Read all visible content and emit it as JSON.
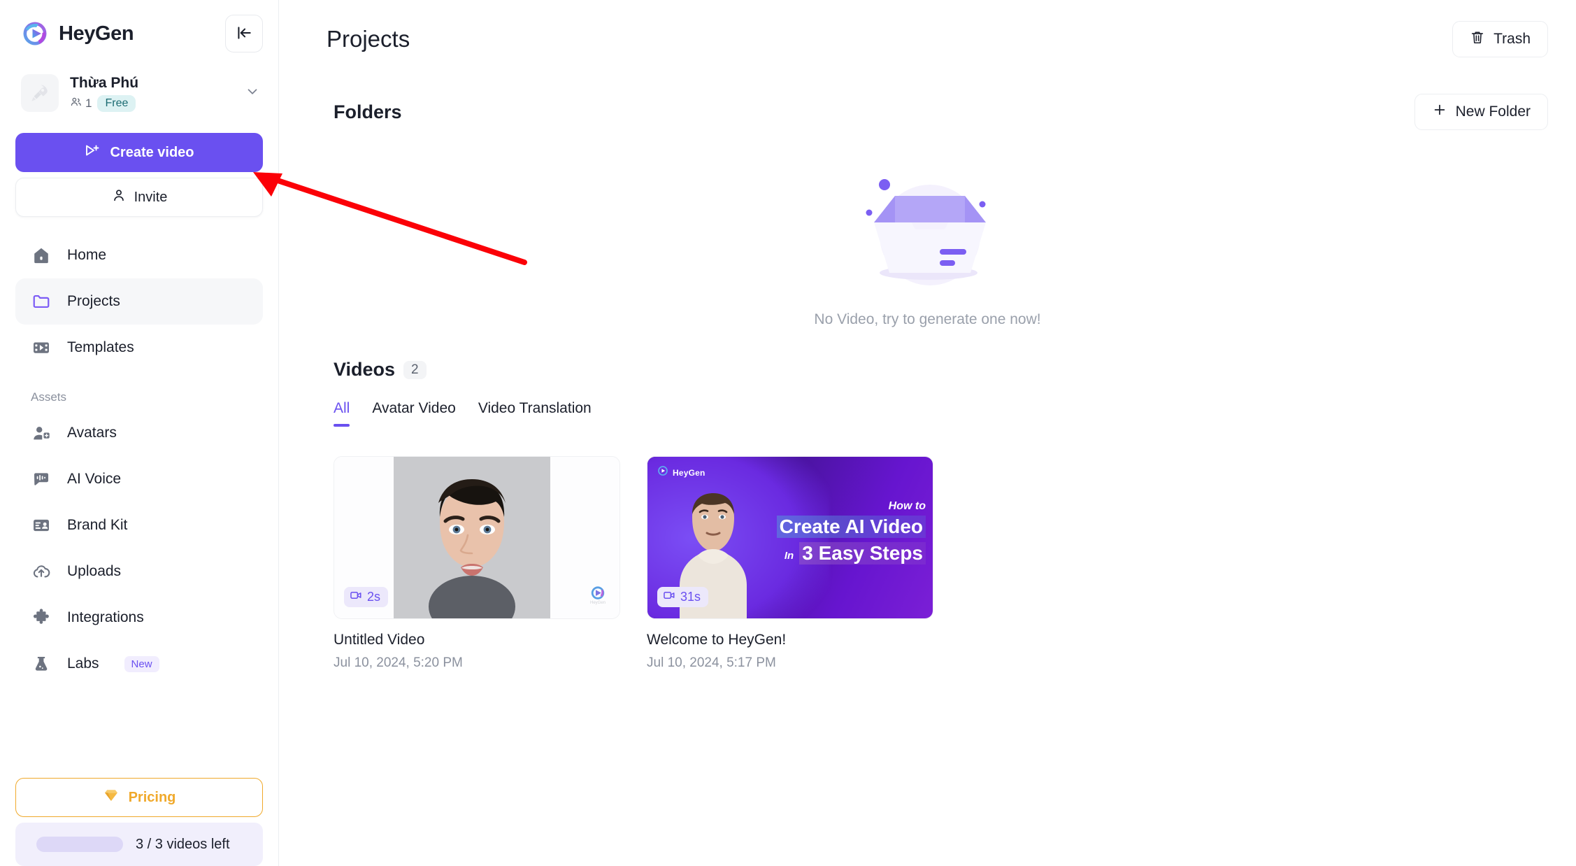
{
  "brand": {
    "name": "HeyGen",
    "logo_icon": "heygen-logo-icon",
    "collapse_icon": "collapse-sidebar-icon"
  },
  "workspace": {
    "name": "Thừa Phú",
    "members_count": "1",
    "plan": "Free",
    "avatar_icon": "rocket-icon",
    "chevron_icon": "chevron-down-icon"
  },
  "actions": {
    "create_video": "Create video",
    "create_video_icon": "video-plus-icon",
    "invite": "Invite",
    "invite_icon": "user-icon"
  },
  "nav": {
    "items": [
      {
        "label": "Home",
        "icon": "home-icon",
        "active": false
      },
      {
        "label": "Projects",
        "icon": "folder-icon",
        "active": true
      },
      {
        "label": "Templates",
        "icon": "templates-icon",
        "active": false
      }
    ],
    "assets_label": "Assets",
    "assets": [
      {
        "label": "Avatars",
        "icon": "avatar-add-icon",
        "badge": ""
      },
      {
        "label": "AI Voice",
        "icon": "voice-icon",
        "badge": ""
      },
      {
        "label": "Brand Kit",
        "icon": "brand-kit-icon",
        "badge": ""
      },
      {
        "label": "Uploads",
        "icon": "cloud-upload-icon",
        "badge": ""
      },
      {
        "label": "Integrations",
        "icon": "puzzle-icon",
        "badge": ""
      },
      {
        "label": "Labs",
        "icon": "flask-icon",
        "badge": "New"
      }
    ]
  },
  "footer": {
    "pricing": "Pricing",
    "pricing_icon": "diamond-icon",
    "quota_text": "3 / 3 videos left",
    "quota_percent": 100
  },
  "header": {
    "title": "Projects",
    "trash": "Trash",
    "trash_icon": "trash-icon"
  },
  "folders": {
    "title": "Folders",
    "new_folder": "New Folder",
    "new_folder_icon": "plus-icon",
    "empty_text": "No Video, try to generate one now!",
    "empty_illustration": "empty-tray-illustration"
  },
  "videos": {
    "title": "Videos",
    "count": "2",
    "tabs": [
      {
        "label": "All",
        "active": true
      },
      {
        "label": "Avatar Video",
        "active": false
      },
      {
        "label": "Video Translation",
        "active": false
      }
    ],
    "items": [
      {
        "title": "Untitled Video",
        "date": "Jul 10, 2024, 5:20 PM",
        "duration": "2s",
        "duration_icon": "video-camera-icon",
        "thumb_kind": "portrait-avatar",
        "watermark": "HeyGen"
      },
      {
        "title": "Welcome to HeyGen!",
        "date": "Jul 10, 2024, 5:17 PM",
        "duration": "31s",
        "duration_icon": "video-camera-icon",
        "thumb_kind": "promo",
        "overlay": {
          "brand": "HeyGen",
          "kicker": "How to",
          "line1": "Create AI Video",
          "connector": "In",
          "line2": "3 Easy Steps"
        }
      }
    ]
  },
  "colors": {
    "accent": "#6a50f0",
    "pricing": "#f0a92b",
    "annotation": "#fb0007",
    "plan_badge_bg": "#ddf2f3",
    "plan_badge_text": "#1b6b72"
  }
}
